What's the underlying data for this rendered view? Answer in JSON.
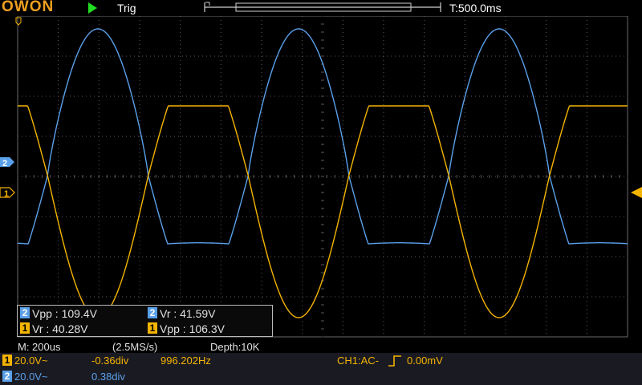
{
  "header": {
    "logo": "OWON",
    "run_state_icon": "play-icon",
    "trigger_status": "Trig",
    "timebase_position": "T:500.0ms"
  },
  "colors": {
    "ch1": "#f4b400",
    "ch2": "#5aa0ea",
    "grid": "#5a5a5a",
    "background": "#000000"
  },
  "markers": {
    "ch2_marker": "2",
    "ch1_marker": "1"
  },
  "measurements": {
    "row1": [
      {
        "channel": "2",
        "text": "Vpp : 109.4V"
      },
      {
        "channel": "2",
        "text": "Vr : 41.59V"
      }
    ],
    "row2": [
      {
        "channel": "1",
        "text": "Vr : 40.28V"
      },
      {
        "channel": "1",
        "text": "Vpp : 106.3V"
      }
    ]
  },
  "acquisition": {
    "timebase": "M: 200us",
    "sample_rate": "(2.5MS/s)",
    "depth": "Depth:10K"
  },
  "channels": [
    {
      "id": "1",
      "scale": "20.0V~",
      "offset": "-0.36div",
      "frequency": "996.202Hz"
    },
    {
      "id": "2",
      "scale": "20.0V~",
      "offset": "0.38div"
    }
  ],
  "trigger": {
    "source_coupling": "CH1:AC-",
    "edge_icon": "rising-edge-icon",
    "level": "0.00mV"
  }
}
